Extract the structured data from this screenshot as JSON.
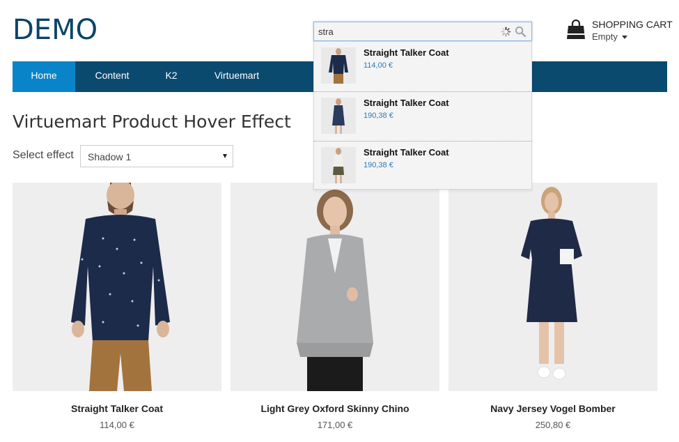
{
  "site": {
    "logo": "DEMO"
  },
  "search": {
    "value": "stra",
    "placeholder": ""
  },
  "cart": {
    "title": "SHOPPING CART",
    "status": "Empty"
  },
  "nav": {
    "items": [
      {
        "label": "Home",
        "active": true
      },
      {
        "label": "Content",
        "active": false
      },
      {
        "label": "K2",
        "active": false
      },
      {
        "label": "Virtuemart",
        "active": false
      }
    ]
  },
  "page": {
    "title": "Virtuemart Product Hover Effect",
    "effect_label": "Select effect",
    "effect_value": "Shadow 1"
  },
  "search_results": [
    {
      "name": "Straight Talker Coat",
      "price": "114,00 €"
    },
    {
      "name": "Straight Talker Coat",
      "price": "190,38 €"
    },
    {
      "name": "Straight Talker Coat",
      "price": "190,38 €"
    }
  ],
  "products": [
    {
      "name": "Straight Talker Coat",
      "price": "114,00 €"
    },
    {
      "name": "Light Grey Oxford Skinny Chino",
      "price": "171,00 €"
    },
    {
      "name": "Navy Jersey Vogel Bomber",
      "price": "250,80 €"
    }
  ],
  "colors": {
    "brand": "#0b4469",
    "nav_bg": "#0b4a6f",
    "nav_active": "#0a84c9",
    "price_link": "#2a7ab8"
  }
}
